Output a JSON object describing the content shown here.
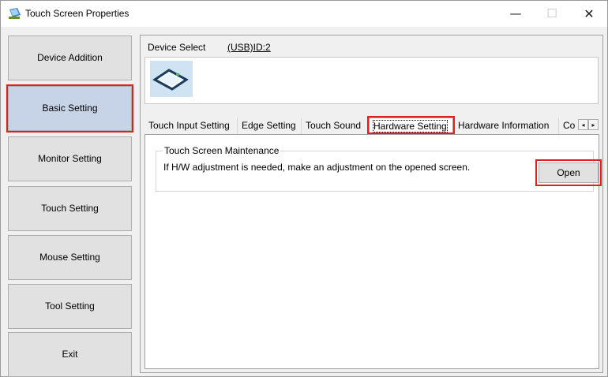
{
  "window": {
    "title": "Touch Screen Properties",
    "minimize_glyph": "—",
    "maximize_glyph": "☐",
    "close_glyph": "✕"
  },
  "nav": {
    "items": [
      {
        "label": "Device Addition"
      },
      {
        "label": "Basic Setting"
      },
      {
        "label": "Monitor Setting"
      },
      {
        "label": "Touch Setting"
      },
      {
        "label": "Mouse Setting"
      },
      {
        "label": "Tool Setting"
      },
      {
        "label": "Exit"
      }
    ],
    "selected": "Basic Setting"
  },
  "device": {
    "label": "Device Select",
    "value": "(USB)ID:2",
    "icon": "touch-screen-device-icon"
  },
  "tabs": {
    "items": [
      {
        "label": "Touch Input Setting"
      },
      {
        "label": "Edge Setting"
      },
      {
        "label": "Touch Sound"
      },
      {
        "label": "Hardware Setting"
      },
      {
        "label": "Hardware Information"
      },
      {
        "label": "Co"
      }
    ],
    "active": "Hardware Setting",
    "scroll_left": "◂",
    "scroll_right": "▸"
  },
  "maintenance": {
    "group_title": "Touch Screen Maintenance",
    "text": "If H/W adjustment is needed, make an adjustment on the opened screen.",
    "button": "Open"
  },
  "colors": {
    "highlight": "#e0201e",
    "selected_nav": "#c7d3e6",
    "button_face": "#e1e1e1"
  }
}
